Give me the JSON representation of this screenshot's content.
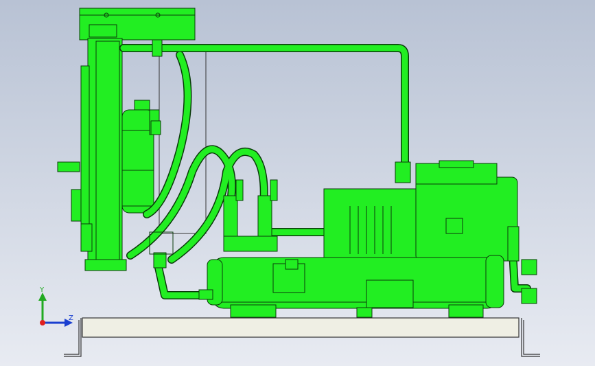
{
  "triad": {
    "y_label": "Y",
    "z_label": "Z",
    "y_color": "#22aa22",
    "z_color": "#1a3fd0",
    "origin_color": "#e02020"
  },
  "colors": {
    "bg_top": "#b8c2d4",
    "bg_bottom": "#e8ebf2",
    "part": "#22ee22",
    "edge": "#0a3a0a",
    "base": "#efefe4",
    "base_edge": "#333333"
  }
}
